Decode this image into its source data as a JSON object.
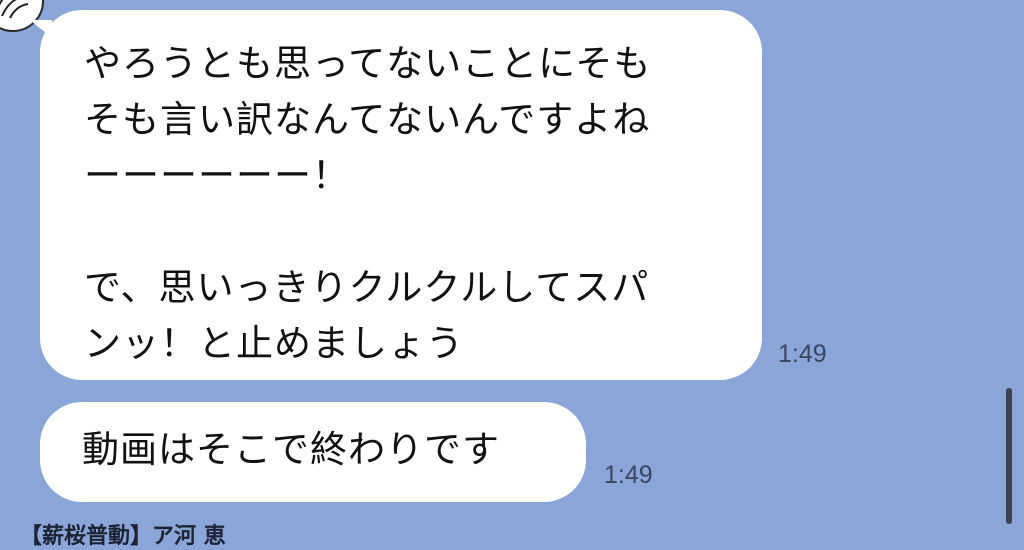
{
  "messages": [
    {
      "lines": [
        "やろうとも思ってないことにそも",
        "そも言い訳なんてないんですよね",
        "ーーーーーー！",
        "",
        "で、思いっきりクルクルしてスパ",
        "ンッ！と止めましょう"
      ],
      "time": "1:49"
    },
    {
      "lines": [
        "動画はそこで終わりです"
      ],
      "time": "1:49"
    }
  ],
  "next_sender": "【薪桜普動】ア河 恵",
  "colors": {
    "background": "#8aa5d8",
    "bubble": "#ffffff",
    "text": "#111111",
    "timestamp": "#3a4660"
  },
  "icons": {
    "avatar": "sender-avatar-icon"
  }
}
